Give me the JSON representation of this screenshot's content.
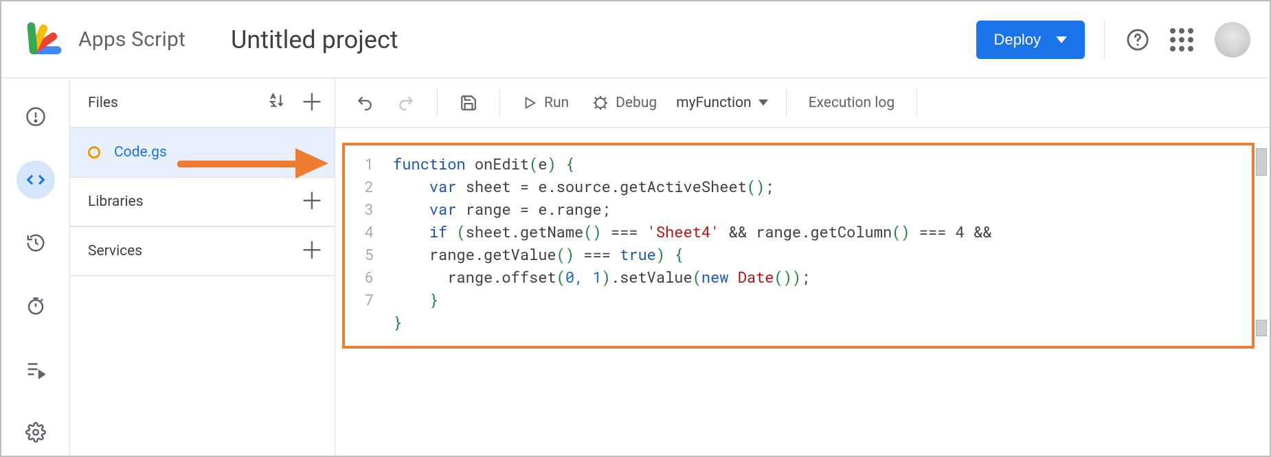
{
  "header": {
    "brand": "Apps Script",
    "project": "Untitled project",
    "deploy_label": "Deploy"
  },
  "rail": {
    "items": [
      "info",
      "editor",
      "history",
      "triggers",
      "executions",
      "settings"
    ]
  },
  "sidebar": {
    "files_label": "Files",
    "file_name": "Code.gs",
    "libraries_label": "Libraries",
    "services_label": "Services"
  },
  "toolbar": {
    "run_label": "Run",
    "debug_label": "Debug",
    "function_name": "myFunction",
    "execlog_label": "Execution log"
  },
  "editor": {
    "line_numbers": [
      "1",
      "2",
      "3",
      "4",
      "5",
      "6",
      "7"
    ],
    "code_plain": "function onEdit(e) {\n    var sheet = e.source.getActiveSheet();\n    var range = e.range;\n    if (sheet.getName() === 'Sheet4' && range.getColumn() === 4 &&\n    range.getValue() === true) {\n      range.offset(0, 1).setValue(new Date());\n    }\n}",
    "tokens": [
      {
        "t": "function ",
        "c": "kw"
      },
      {
        "t": "onEdit",
        "c": "fn"
      },
      {
        "t": "(",
        "c": "pn"
      },
      {
        "t": "e",
        "c": "fn"
      },
      {
        "t": ")",
        "c": "pn"
      },
      {
        "t": " ",
        "c": ""
      },
      {
        "t": "{",
        "c": "pn"
      },
      {
        "t": "\n",
        "c": ""
      },
      {
        "t": "    ",
        "c": ""
      },
      {
        "t": "var ",
        "c": "kw"
      },
      {
        "t": "sheet = e.source.getActiveSheet",
        "c": "fn"
      },
      {
        "t": "()",
        "c": "pn"
      },
      {
        "t": ";",
        "c": "fn"
      },
      {
        "t": "\n",
        "c": ""
      },
      {
        "t": "    ",
        "c": ""
      },
      {
        "t": "var ",
        "c": "kw"
      },
      {
        "t": "range = e.range;",
        "c": "fn"
      },
      {
        "t": "\n",
        "c": ""
      },
      {
        "t": "    ",
        "c": ""
      },
      {
        "t": "if ",
        "c": "kw"
      },
      {
        "t": "(",
        "c": "pn"
      },
      {
        "t": "sheet.getName",
        "c": "fn"
      },
      {
        "t": "()",
        "c": "pn"
      },
      {
        "t": " === ",
        "c": "fn"
      },
      {
        "t": "'Sheet4'",
        "c": "str"
      },
      {
        "t": " && range.getColumn",
        "c": "fn"
      },
      {
        "t": "()",
        "c": "pn"
      },
      {
        "t": " === 4 &&",
        "c": "fn"
      },
      {
        "t": "\n",
        "c": ""
      },
      {
        "t": "    range.getValue",
        "c": "fn"
      },
      {
        "t": "()",
        "c": "pn"
      },
      {
        "t": " === ",
        "c": "fn"
      },
      {
        "t": "true",
        "c": "kw"
      },
      {
        "t": ")",
        "c": "pn"
      },
      {
        "t": " ",
        "c": ""
      },
      {
        "t": "{",
        "c": "pn"
      },
      {
        "t": "\n",
        "c": ""
      },
      {
        "t": "      range.offset",
        "c": "fn"
      },
      {
        "t": "(",
        "c": "pn"
      },
      {
        "t": "0, 1",
        "c": "lit"
      },
      {
        "t": ")",
        "c": "pn"
      },
      {
        "t": ".setValue",
        "c": "fn"
      },
      {
        "t": "(",
        "c": "pn"
      },
      {
        "t": "new ",
        "c": "kw"
      },
      {
        "t": "Date",
        "c": "str"
      },
      {
        "t": "())",
        "c": "pn"
      },
      {
        "t": ";",
        "c": "fn"
      },
      {
        "t": "\n",
        "c": ""
      },
      {
        "t": "    ",
        "c": ""
      },
      {
        "t": "}",
        "c": "pn"
      },
      {
        "t": "\n",
        "c": ""
      },
      {
        "t": "}",
        "c": "pn"
      }
    ]
  },
  "colors": {
    "accent": "#1a73e8",
    "annotation": "#ed7d31"
  }
}
